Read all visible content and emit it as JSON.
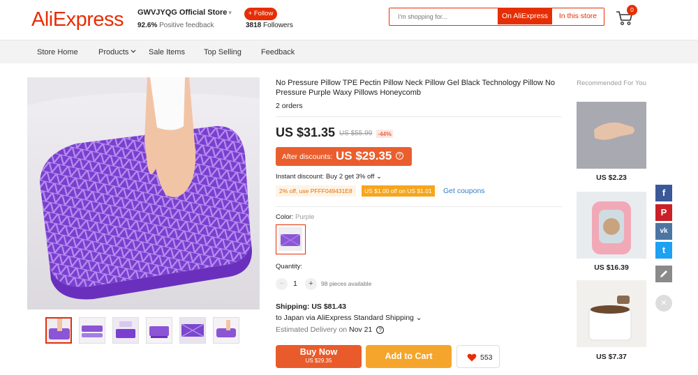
{
  "header": {
    "logo": "AliExpress",
    "store_name": "GWVJYQG Official Store",
    "store_caret": "▾",
    "feedback_value": "92.6%",
    "feedback_label": "Positive feedback",
    "follow_label": "+ Follow",
    "followers_count": "3818",
    "followers_label": "Followers",
    "search_placeholder": "I'm shopping for...",
    "search_aliexpress": "On AliExpress",
    "search_store": "In this store",
    "cart_count": "0"
  },
  "nav": {
    "items": [
      "Store Home",
      "Products",
      "Sale Items",
      "Top Selling",
      "Feedback"
    ]
  },
  "product": {
    "title": "No Pressure Pillow TPE Pectin Pillow Neck Pillow Gel Black Technology Pillow No Pressure Purple Waxy Pillows Honeycomb",
    "orders": "2 orders",
    "price": "US $31.35",
    "old_price": "US $55.99",
    "discount_pct": "-44%",
    "after_discount_label": "After discounts:",
    "after_discount_price": "US $29.35",
    "help_icon": "?",
    "instant_discount": "Instant discount: Buy 2 get 3% off",
    "instant_caret": "⌄",
    "coupon_code": "2% off, use PFFF049431E8",
    "coupon_store": "US $1.00 off on US $1.01",
    "get_coupons": "Get coupons",
    "color_label": "Color:",
    "color_value": "Purple",
    "quantity_label": "Quantity:",
    "quantity_minus": "−",
    "quantity_value": "1",
    "quantity_plus": "+",
    "pieces_available": "98 pieces available",
    "shipping": "Shipping: US $81.43",
    "ship_to": "to Japan via AliExpress Standard Shipping",
    "ship_caret": "⌄",
    "est_label": "Estimated Delivery on",
    "est_date": "Nov 21",
    "buy_now": "Buy Now",
    "buy_now_price": "US $29.35",
    "add_to_cart": "Add to Cart",
    "wishlist_count": "553"
  },
  "recommended": {
    "title": "Recommended For You",
    "items": [
      {
        "price": "US $2.23"
      },
      {
        "price": "US $16.39"
      },
      {
        "price": "US $7.37"
      }
    ]
  },
  "social": {
    "facebook": "f",
    "pinterest": "P",
    "vk": "vk",
    "twitter": "t",
    "close": "×"
  },
  "colors": {
    "brand": "#e62e04",
    "purple": "#8b55d6",
    "facebook": "#3b5998",
    "pinterest": "#cb2027",
    "vk": "#4c75a3",
    "twitter": "#1da1f2"
  }
}
